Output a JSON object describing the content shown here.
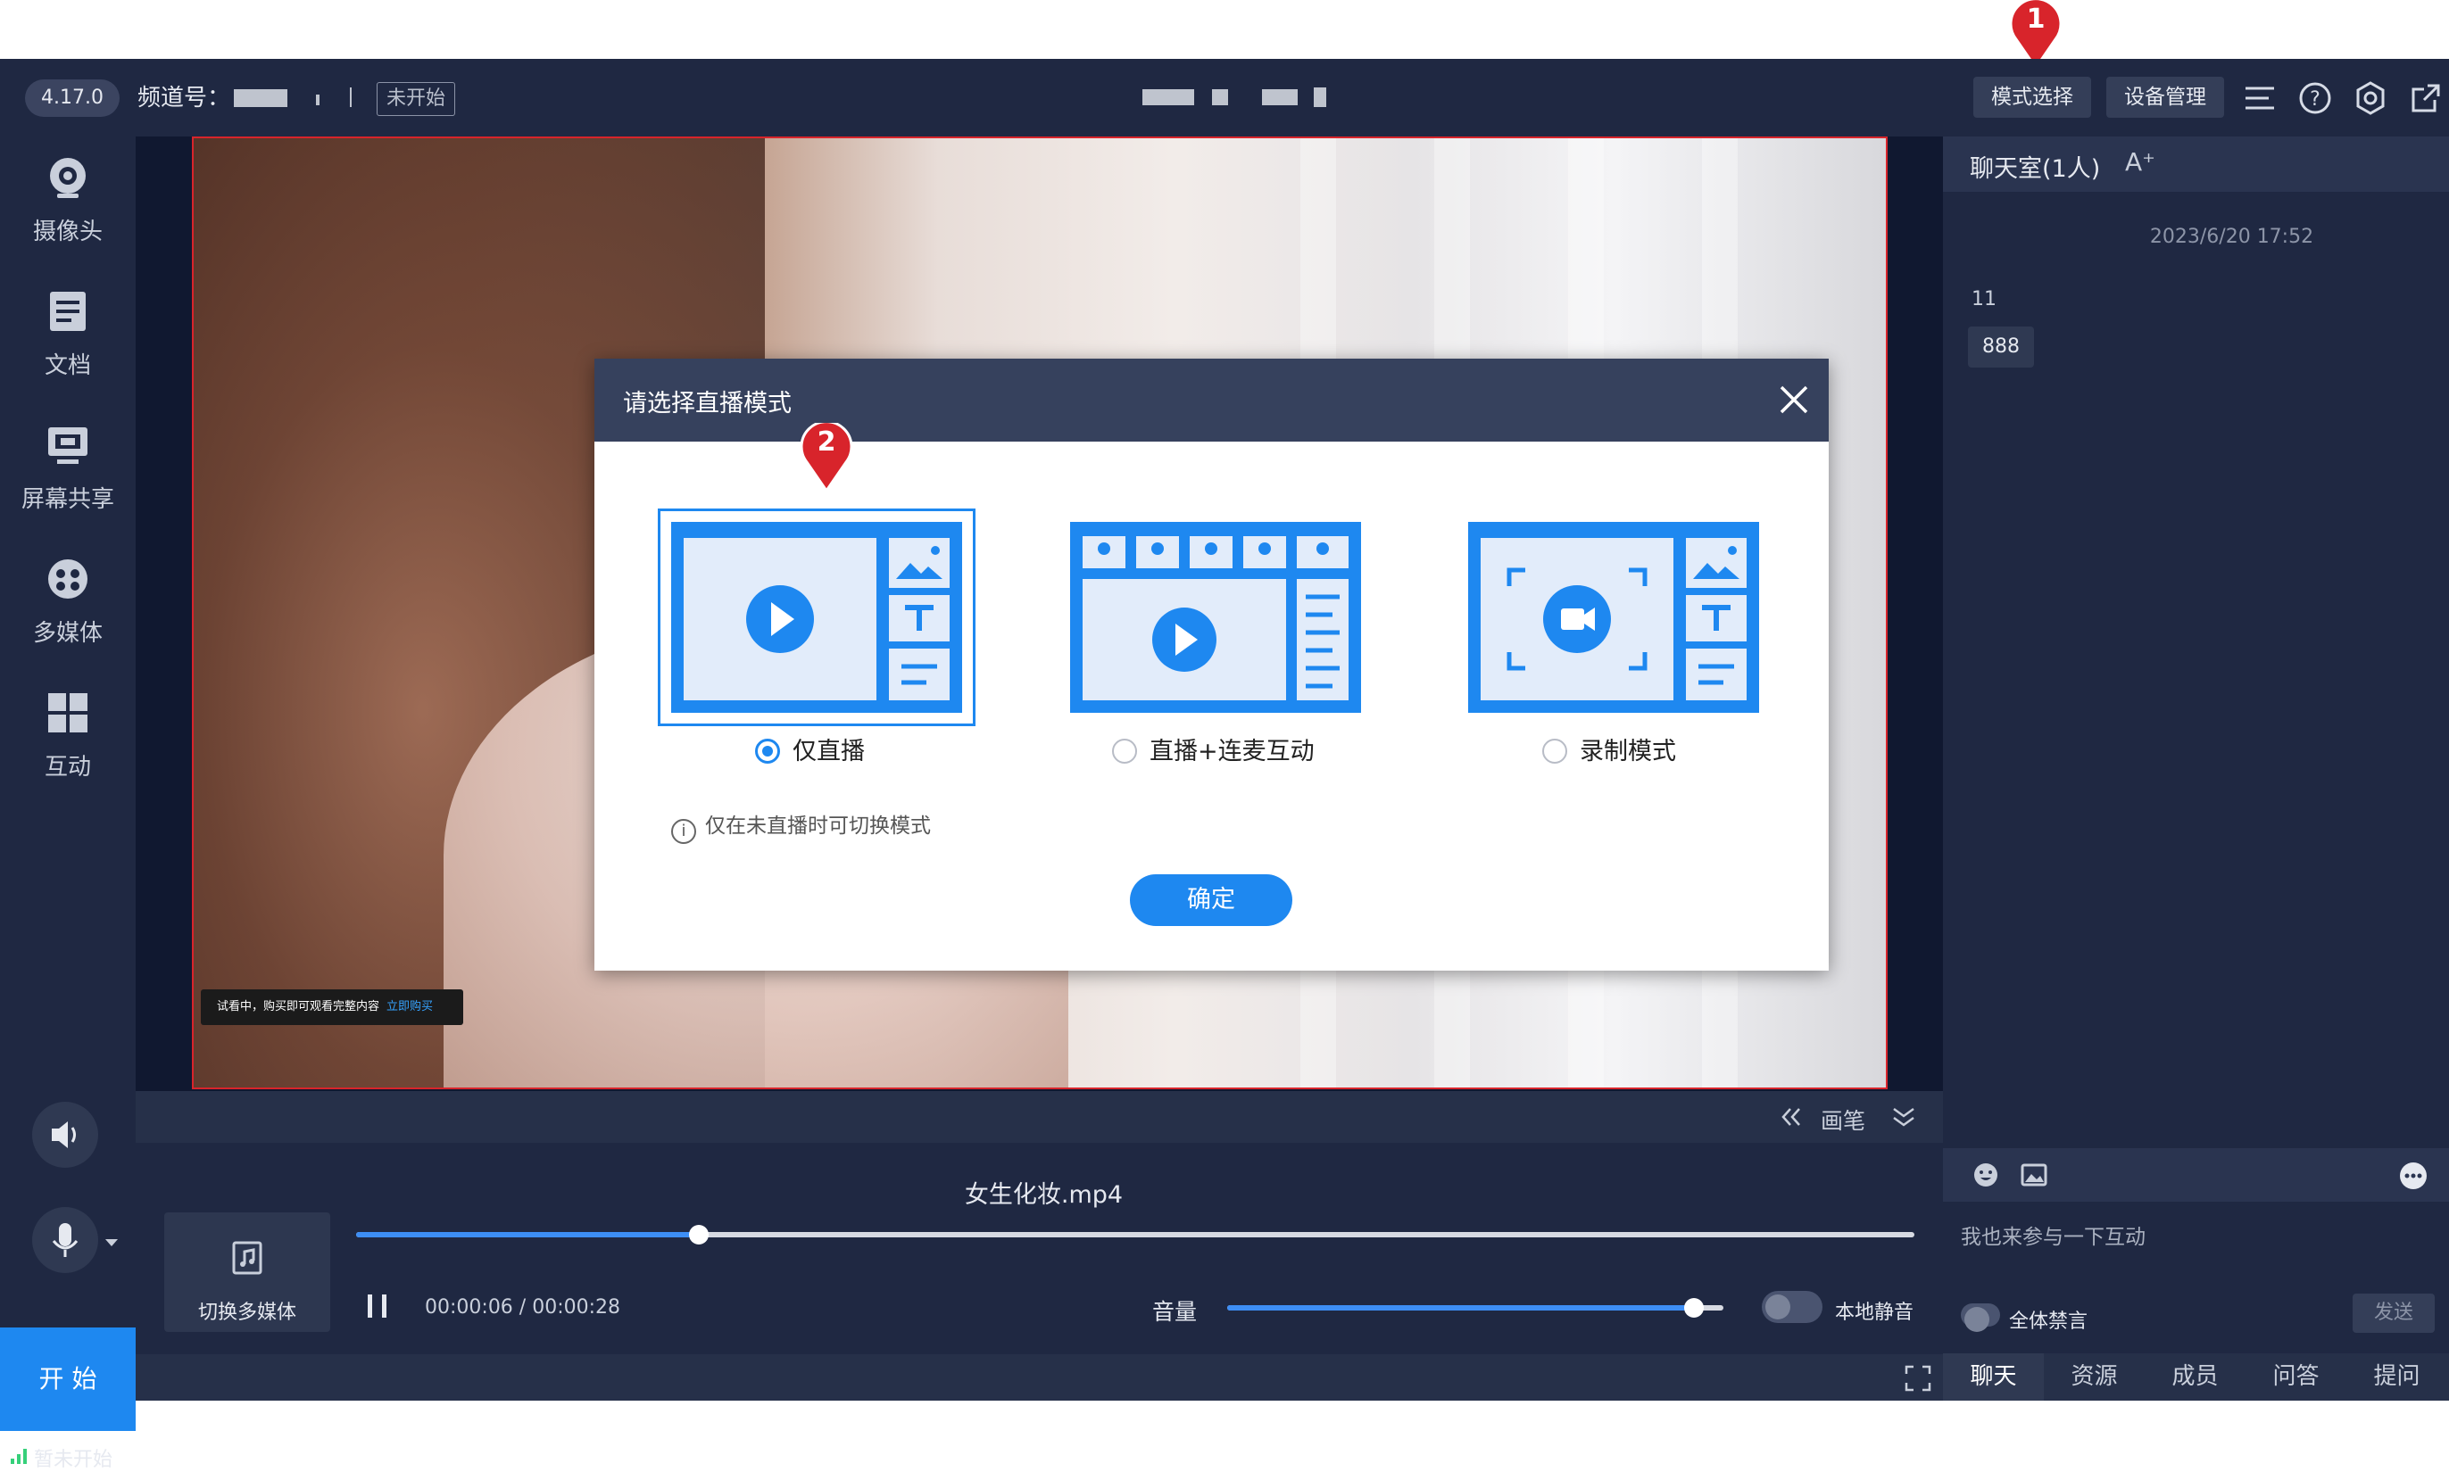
{
  "topbar": {
    "version": "4.17.0",
    "channel_label": "频道号：",
    "status": "未开始",
    "mode_button": "模式选择",
    "device_button": "设备管理"
  },
  "leftnav": {
    "items": [
      {
        "label": "摄像头",
        "icon": "camera-icon"
      },
      {
        "label": "文档",
        "icon": "document-icon"
      },
      {
        "label": "屏幕共享",
        "icon": "screen-share-icon"
      },
      {
        "label": "多媒体",
        "icon": "multimedia-icon"
      },
      {
        "label": "互动",
        "icon": "interaction-icon"
      }
    ],
    "start_label": "开 始",
    "live_status": "暂未开始"
  },
  "stage": {
    "trial_text": "试看中，购买即可观看完整内容",
    "trial_link": "立即购买",
    "brush_label": "画笔"
  },
  "media": {
    "filename": "女生化妆.mp4",
    "switch_label": "切换多媒体",
    "current_time": "00:00:06",
    "total_time": "00:00:28",
    "progress": 0.22,
    "volume_label": "音量",
    "volume": 0.94,
    "local_mute_label": "本地静音"
  },
  "chat": {
    "title": "聊天室(1人)",
    "font_icon": "A⁺",
    "timestamp": "2023/6/20 17:52",
    "messages": [
      "11",
      "888"
    ],
    "input_placeholder": "我也来参与一下互动",
    "mute_all_label": "全体禁言",
    "send_label": "发送",
    "tabs": [
      "聊天",
      "资源",
      "成员",
      "问答",
      "提问"
    ]
  },
  "dialog": {
    "title": "请选择直播模式",
    "options": [
      "仅直播",
      "直播+连麦互动",
      "录制模式"
    ],
    "selected": 0,
    "tip": "仅在未直播时可切换模式",
    "confirm": "确定"
  },
  "markers": [
    "1",
    "2"
  ],
  "colors": {
    "accent": "#1e88f0",
    "marker": "#d8242b",
    "panel": "#1f2842"
  }
}
